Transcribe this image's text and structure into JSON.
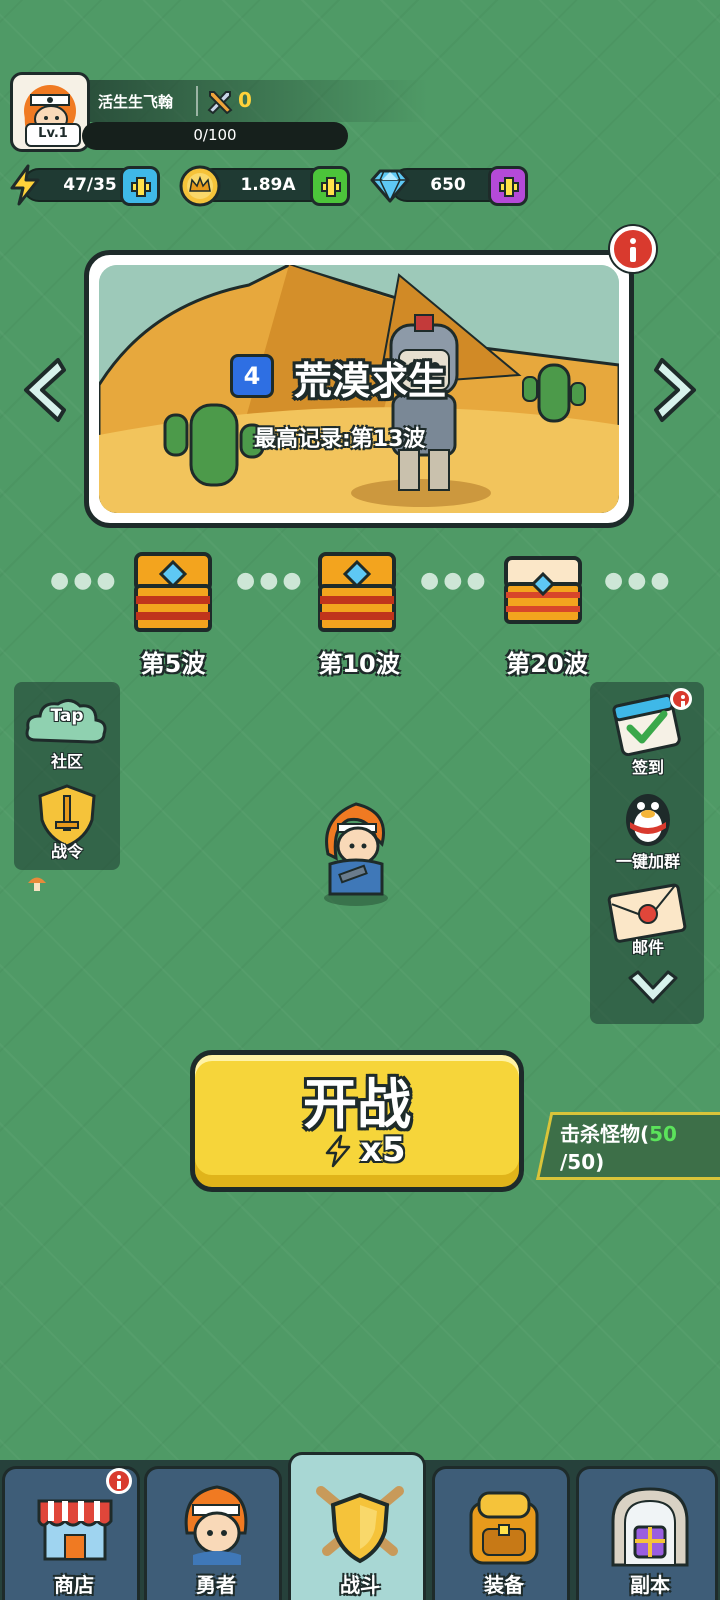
{
  "player": {
    "name": "活生生飞翰",
    "level": "Lv.1",
    "power": "0",
    "exp": "0/100"
  },
  "resources": {
    "energy": "47/35",
    "gold": "1.89A",
    "gems": "650"
  },
  "stage": {
    "number": "4",
    "title": "荒漠求生",
    "record": "最高记录:第13波"
  },
  "rewards": [
    {
      "label": "第5波"
    },
    {
      "label": "第10波"
    },
    {
      "label": "第20波"
    }
  ],
  "left_menu": [
    {
      "icon_text": "Tap",
      "label": "社区"
    },
    {
      "label": "战令"
    }
  ],
  "right_menu": [
    {
      "label": "签到"
    },
    {
      "label": "一键加群"
    },
    {
      "label": "邮件"
    }
  ],
  "battle": {
    "title": "开战",
    "cost": "x5"
  },
  "quest": {
    "text_prefix": "击杀怪物(",
    "current": "50",
    "total": "/50)"
  },
  "nav": [
    {
      "label": "商店"
    },
    {
      "label": "勇者"
    },
    {
      "label": "战斗"
    },
    {
      "label": "装备"
    },
    {
      "label": "副本"
    }
  ],
  "colors": {
    "background": "#4f9a66",
    "button_yellow": "#f6d53a",
    "gem_purple": "#b44ad8",
    "gold_green": "#4cc43a",
    "energy_blue": "#3fb8e8",
    "alert_red": "#d93a2e",
    "quest_progress": "#5be35b"
  },
  "icons": [
    "avatar",
    "sword-power-icon",
    "lightning-icon",
    "crown-coin-icon",
    "diamond-icon",
    "plus-icon",
    "info-icon",
    "arrow-left-icon",
    "arrow-right-icon",
    "chest-icon",
    "tap-cloud-icon",
    "shield-sword-icon",
    "calendar-check-icon",
    "penguin-icon",
    "mail-icon",
    "chevron-down-icon",
    "shop-icon",
    "hero-icon",
    "battle-icon",
    "backpack-icon",
    "dungeon-door-icon"
  ]
}
